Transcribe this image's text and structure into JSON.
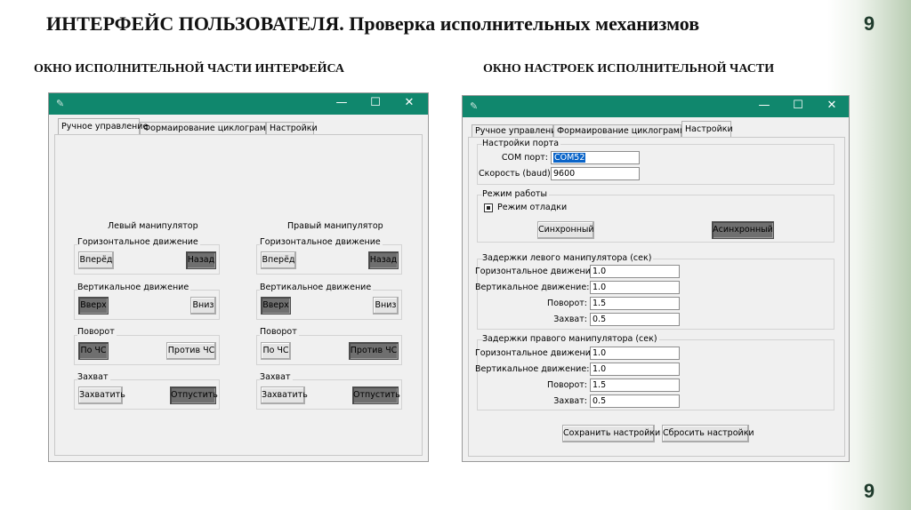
{
  "slide": {
    "title": "ИНТЕРФЕЙС ПОЛЬЗОВАТЕЛЯ. Проверка исполнительных механизмов",
    "number_top": "9",
    "number_bottom": "9",
    "left_caption": "ОКНО ИСПОЛНИТЕЛЬНОЙ ЧАСТИ ИНТЕРФЕЙСА",
    "right_caption": "ОКНО НАСТРОЕК ИСПОЛНИТЕЛЬНОЙ ЧАСТИ"
  },
  "colors": {
    "titlebar": "#10876d",
    "accent_band": "#b9cdb3",
    "pressed_button": "#6f6f6f"
  },
  "window_controls": {
    "minimize": "—",
    "maximize": "☐",
    "close": "✕",
    "app_icon": "feather-icon"
  },
  "tabs": [
    "Ручное управление",
    "Формаирование циклограммы",
    "Настройки"
  ],
  "left_window": {
    "active_tab": "Ручное управление",
    "left_manip": {
      "title": "Левый манипулятор",
      "horizontal": {
        "label": "Горизонтальное движение",
        "btn1": "Вперёд",
        "btn2": "Назад"
      },
      "vertical": {
        "label": "Вертикальное движение",
        "btn1": "Вверх",
        "btn2": "Вниз"
      },
      "rotation": {
        "label": "Поворот",
        "btn1": "По ЧС",
        "btn2": "Против ЧС"
      },
      "grip": {
        "label": "Захват",
        "btn1": "Захватить",
        "btn2": "Отпустить"
      }
    },
    "right_manip": {
      "title": "Правый манипулятор",
      "horizontal": {
        "label": "Горизонтальное движение",
        "btn1": "Вперёд",
        "btn2": "Назад"
      },
      "vertical": {
        "label": "Вертикальное движение",
        "btn1": "Вверх",
        "btn2": "Вниз"
      },
      "rotation": {
        "label": "Поворот",
        "btn1": "По ЧС",
        "btn2": "Против ЧС"
      },
      "grip": {
        "label": "Захват",
        "btn1": "Захватить",
        "btn2": "Отпустить"
      }
    }
  },
  "right_window": {
    "active_tab": "Настройки",
    "port": {
      "group": "Настройки порта",
      "com_label": "COM порт:",
      "com_value": "COM52",
      "speed_label": "Скорость (baud):",
      "speed_value": "9600"
    },
    "mode": {
      "group": "Режим работы",
      "debug_label": "Режим отладки",
      "debug_checked": true,
      "sync_button": "Синхронный",
      "async_button": "Асинхронный"
    },
    "left_delays": {
      "group": "Задержки левого манипулятора (сек)",
      "rows": [
        {
          "label": "Горизонтальное движение:",
          "value": "1.0"
        },
        {
          "label": "Вертикальное движение:",
          "value": "1.0"
        },
        {
          "label": "Поворот:",
          "value": "1.5"
        },
        {
          "label": "Захват:",
          "value": "0.5"
        }
      ]
    },
    "right_delays": {
      "group": "Задержки правого манипулятора (сек)",
      "rows": [
        {
          "label": "Горизонтальное движение:",
          "value": "1.0"
        },
        {
          "label": "Вертикальное движение:",
          "value": "1.0"
        },
        {
          "label": "Поворот:",
          "value": "1.5"
        },
        {
          "label": "Захват:",
          "value": "0.5"
        }
      ]
    },
    "save_button": "Сохранить настройки",
    "reset_button": "Сбросить настройки"
  }
}
